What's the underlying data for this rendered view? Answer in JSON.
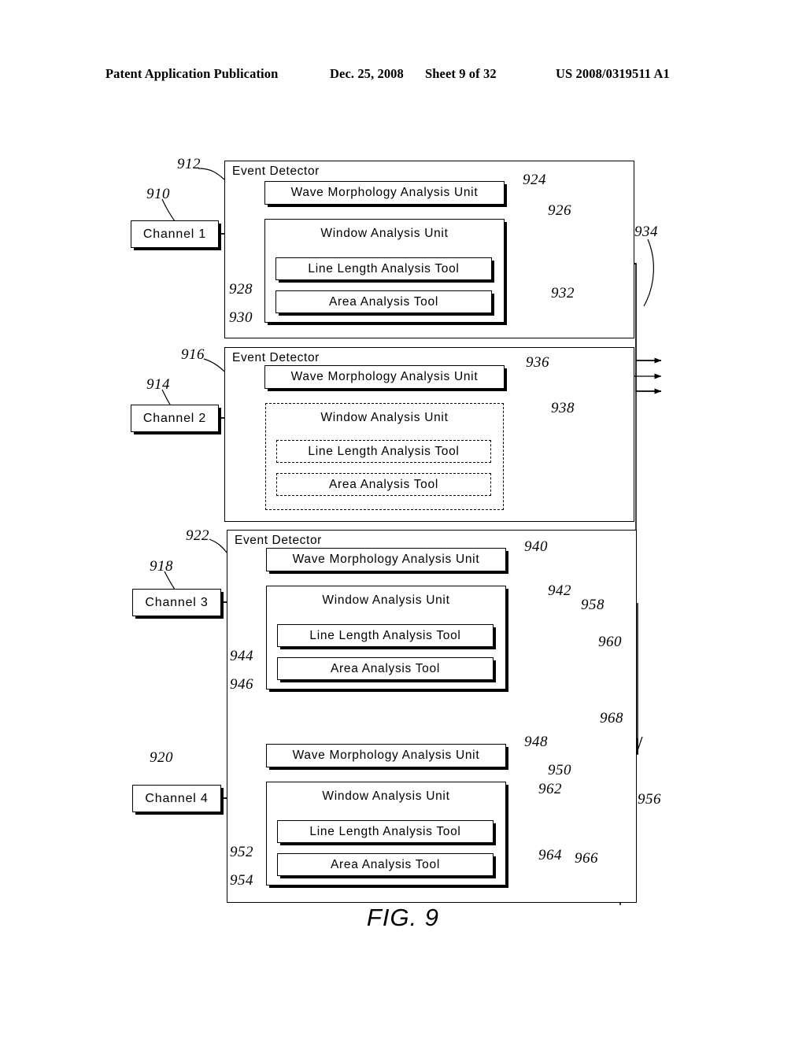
{
  "header": {
    "publication": "Patent Application Publication",
    "date": "Dec. 25, 2008",
    "sheet": "Sheet 9 of 32",
    "patent_number": "US 2008/0319511 A1"
  },
  "figure": {
    "caption": "FIG. 9",
    "detector_label": "Event Detector",
    "labels": {
      "wave_morphology": "Wave Morphology Analysis Unit",
      "window_analysis": "Window Analysis Unit",
      "line_length": "Line Length Analysis Tool",
      "area_analysis": "Area Analysis Tool"
    },
    "channels": [
      {
        "name": "Channel 1",
        "ref": "910"
      },
      {
        "name": "Channel 2",
        "ref": "914"
      },
      {
        "name": "Channel 3",
        "ref": "918"
      },
      {
        "name": "Channel 4",
        "ref": "920"
      }
    ],
    "refs": {
      "r910": "910",
      "r912": "912",
      "r914": "914",
      "r916": "916",
      "r918": "918",
      "r920": "920",
      "r922": "922",
      "r924": "924",
      "r926": "926",
      "r928": "928",
      "r930": "930",
      "r932": "932",
      "r934": "934",
      "r936": "936",
      "r938": "938",
      "r940": "940",
      "r942": "942",
      "r944": "944",
      "r946": "946",
      "r948": "948",
      "r950": "950",
      "r952": "952",
      "r954": "954",
      "r956": "956",
      "r958": "958",
      "r960": "960",
      "r962": "962",
      "r964": "964",
      "r966": "966",
      "r968": "968"
    },
    "blocks": [
      {
        "id": "detector-1",
        "channel": "Channel 1",
        "detector_ref": "912",
        "wave_morphology_ref": "924",
        "window_analysis_ref": "926",
        "line_length_ref": "928",
        "area_analysis_ref": "930",
        "gate_ref": "932",
        "output_ref": "934",
        "window_unit_style": "solid"
      },
      {
        "id": "detector-2",
        "channel": "Channel 2",
        "detector_ref": "916",
        "wave_morphology_ref": "936",
        "window_analysis_ref": "938",
        "window_unit_style": "dashed"
      },
      {
        "id": "detector-3",
        "channel": "Channel 3",
        "detector_ref": "922",
        "wave_morphology_ref": "940",
        "window_analysis_ref": "942",
        "line_length_ref": "944",
        "area_analysis_ref": "946",
        "gate_ref": "958",
        "output_ref": "960",
        "window_unit_style": "solid"
      },
      {
        "id": "detector-4",
        "channel": "Channel 4",
        "wave_morphology_ref": "948",
        "window_analysis_ref": "950",
        "line_length_ref": "952",
        "area_analysis_ref": "954",
        "gate_ref": "962",
        "gate_label_ref": "964",
        "inverter_ref": "966",
        "final_gate_ref": "968",
        "output_ref": "956",
        "window_unit_style": "solid"
      }
    ]
  }
}
